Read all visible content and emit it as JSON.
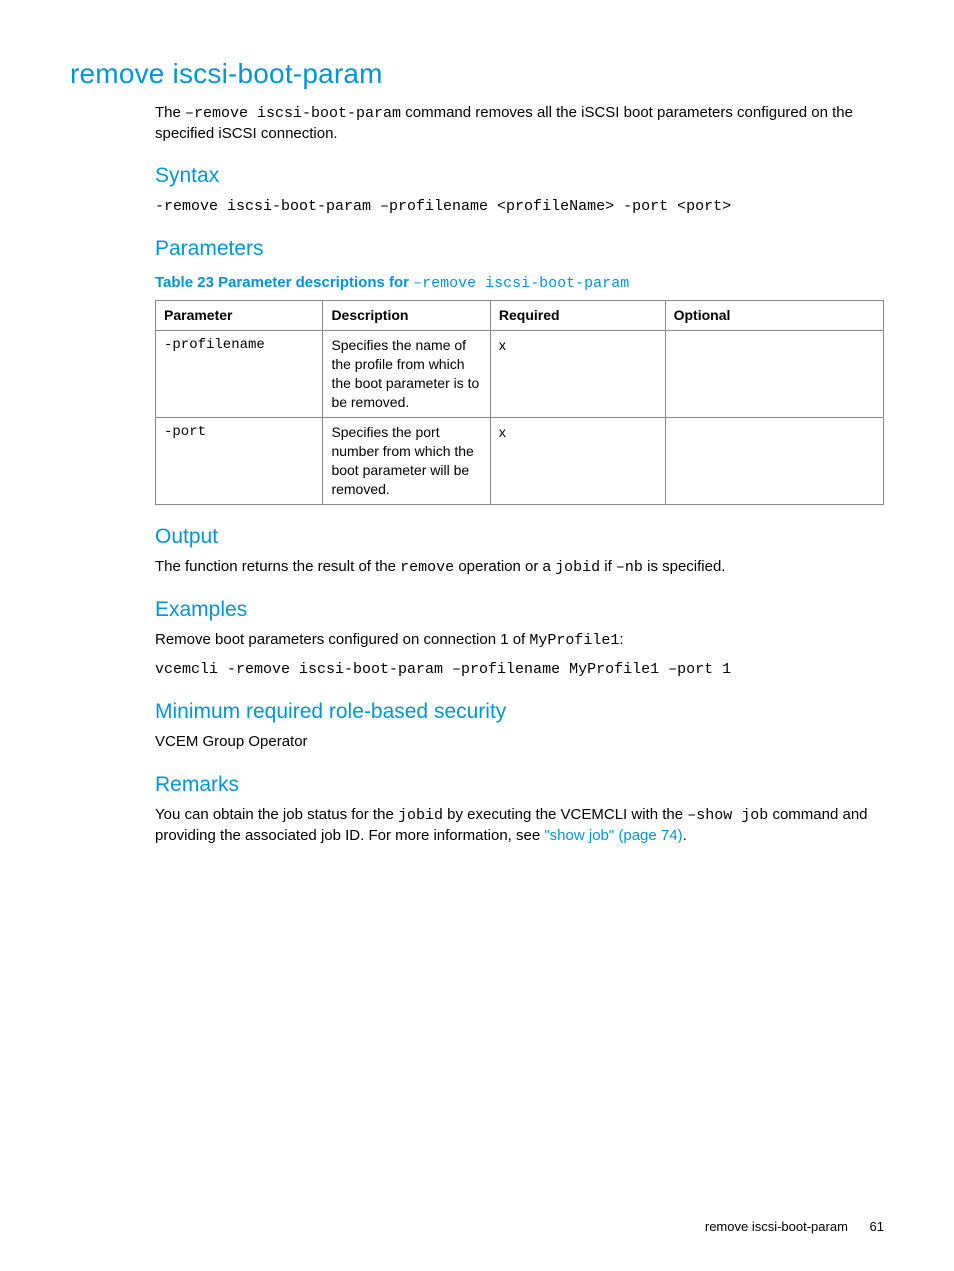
{
  "title": "remove iscsi-boot-param",
  "intro": {
    "pre": "The ",
    "cmd": "–remove iscsi-boot-param",
    "post": " command removes all the iSCSI boot parameters configured on the specified iSCSI connection."
  },
  "syntax": {
    "heading": "Syntax",
    "code": "-remove iscsi-boot-param –profilename <profileName> -port <port>"
  },
  "parameters": {
    "heading": "Parameters",
    "caption_prefix": "Table 23 Parameter descriptions for ",
    "caption_code": "–remove iscsi-boot-param",
    "headers": {
      "c0": "Parameter",
      "c1": "Description",
      "c2": "Required",
      "c3": "Optional"
    },
    "rows": [
      {
        "param": "-profilename",
        "desc": "Specifies the name of the profile from which the boot parameter is to be removed.",
        "req": "x",
        "opt": ""
      },
      {
        "param": "-port",
        "desc": "Specifies the port number from which the boot parameter will be removed.",
        "req": "x",
        "opt": ""
      }
    ]
  },
  "output": {
    "heading": "Output",
    "t1": "The function returns the result of the ",
    "c1": "remove",
    "t2": " operation or a ",
    "c2": "jobid",
    "t3": " if ",
    "c3": "–nb",
    "t4": " is specified."
  },
  "examples": {
    "heading": "Examples",
    "line1_pre": "Remove boot parameters configured on connection 1 of ",
    "line1_code": "MyProfile1",
    "line1_post": ":",
    "code": "vcemcli -remove iscsi-boot-param –profilename MyProfile1 –port 1"
  },
  "security": {
    "heading": "Minimum required role-based security",
    "text": "VCEM Group Operator"
  },
  "remarks": {
    "heading": "Remarks",
    "t1": "You can obtain the job status for the ",
    "c1": "jobid",
    "t2": " by executing the VCEMCLI with the ",
    "c2": "–show job",
    "t3": " command and providing the associated job ID. For more information, see ",
    "link": "\"show job\" (page 74)",
    "t4": "."
  },
  "footer": {
    "label": "remove iscsi-boot-param",
    "page": "61"
  }
}
